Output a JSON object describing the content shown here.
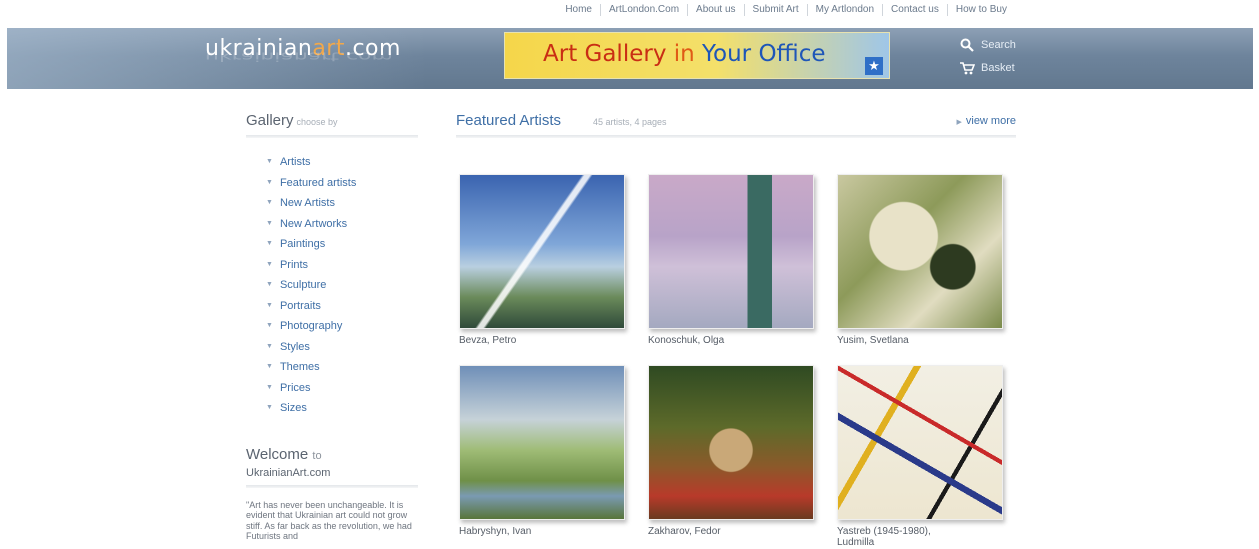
{
  "topnav": {
    "items": [
      "Home",
      "ArtLondon.Com",
      "About us",
      "Submit Art",
      "My Artlondon",
      "Contact us",
      "How to Buy"
    ]
  },
  "header": {
    "logo_main": "ukrainian",
    "logo_accent": "art",
    "logo_tail": ".com",
    "banner": {
      "part1": "Art Gallery ",
      "part2": "in ",
      "part3": "Your Office"
    },
    "search_label": "Search",
    "basket_label": "Basket"
  },
  "sidebar": {
    "title": "Gallery",
    "title_small": "choose by",
    "items": [
      {
        "label": "Artists"
      },
      {
        "label": "Featured artists"
      },
      {
        "label": "New Artists"
      },
      {
        "label": "New Artworks"
      },
      {
        "label": "Paintings"
      },
      {
        "label": "Prints"
      },
      {
        "label": "Sculpture"
      },
      {
        "label": "Portraits"
      },
      {
        "label": "Photography"
      },
      {
        "label": "Styles"
      },
      {
        "label": "Themes"
      },
      {
        "label": "Prices"
      },
      {
        "label": "Sizes"
      }
    ],
    "welcome_title": "Welcome",
    "welcome_to": "to",
    "welcome_site": "UkrainianArt.com",
    "quote": "\"Art has never been unchangeable. It is evident that Ukrainian art could not grow stiff. As far back as the revolution, we had Futurists and"
  },
  "main": {
    "title": "Featured Artists",
    "subtitle": "45 artists, 4 pages",
    "view_more": "view more",
    "artworks": [
      {
        "name": "Bevza, Petro"
      },
      {
        "name": "Konoschuk, Olga"
      },
      {
        "name": "Yusim, Svetlana"
      },
      {
        "name": "Habryshyn, Ivan"
      },
      {
        "name": "Zakharov, Fedor"
      },
      {
        "name": "Yastreb (1945-1980), Ludmilla"
      }
    ]
  },
  "colors": {
    "link": "#3f6fa6",
    "header_band": "#6e849c",
    "logo_accent": "#f2a84a"
  }
}
